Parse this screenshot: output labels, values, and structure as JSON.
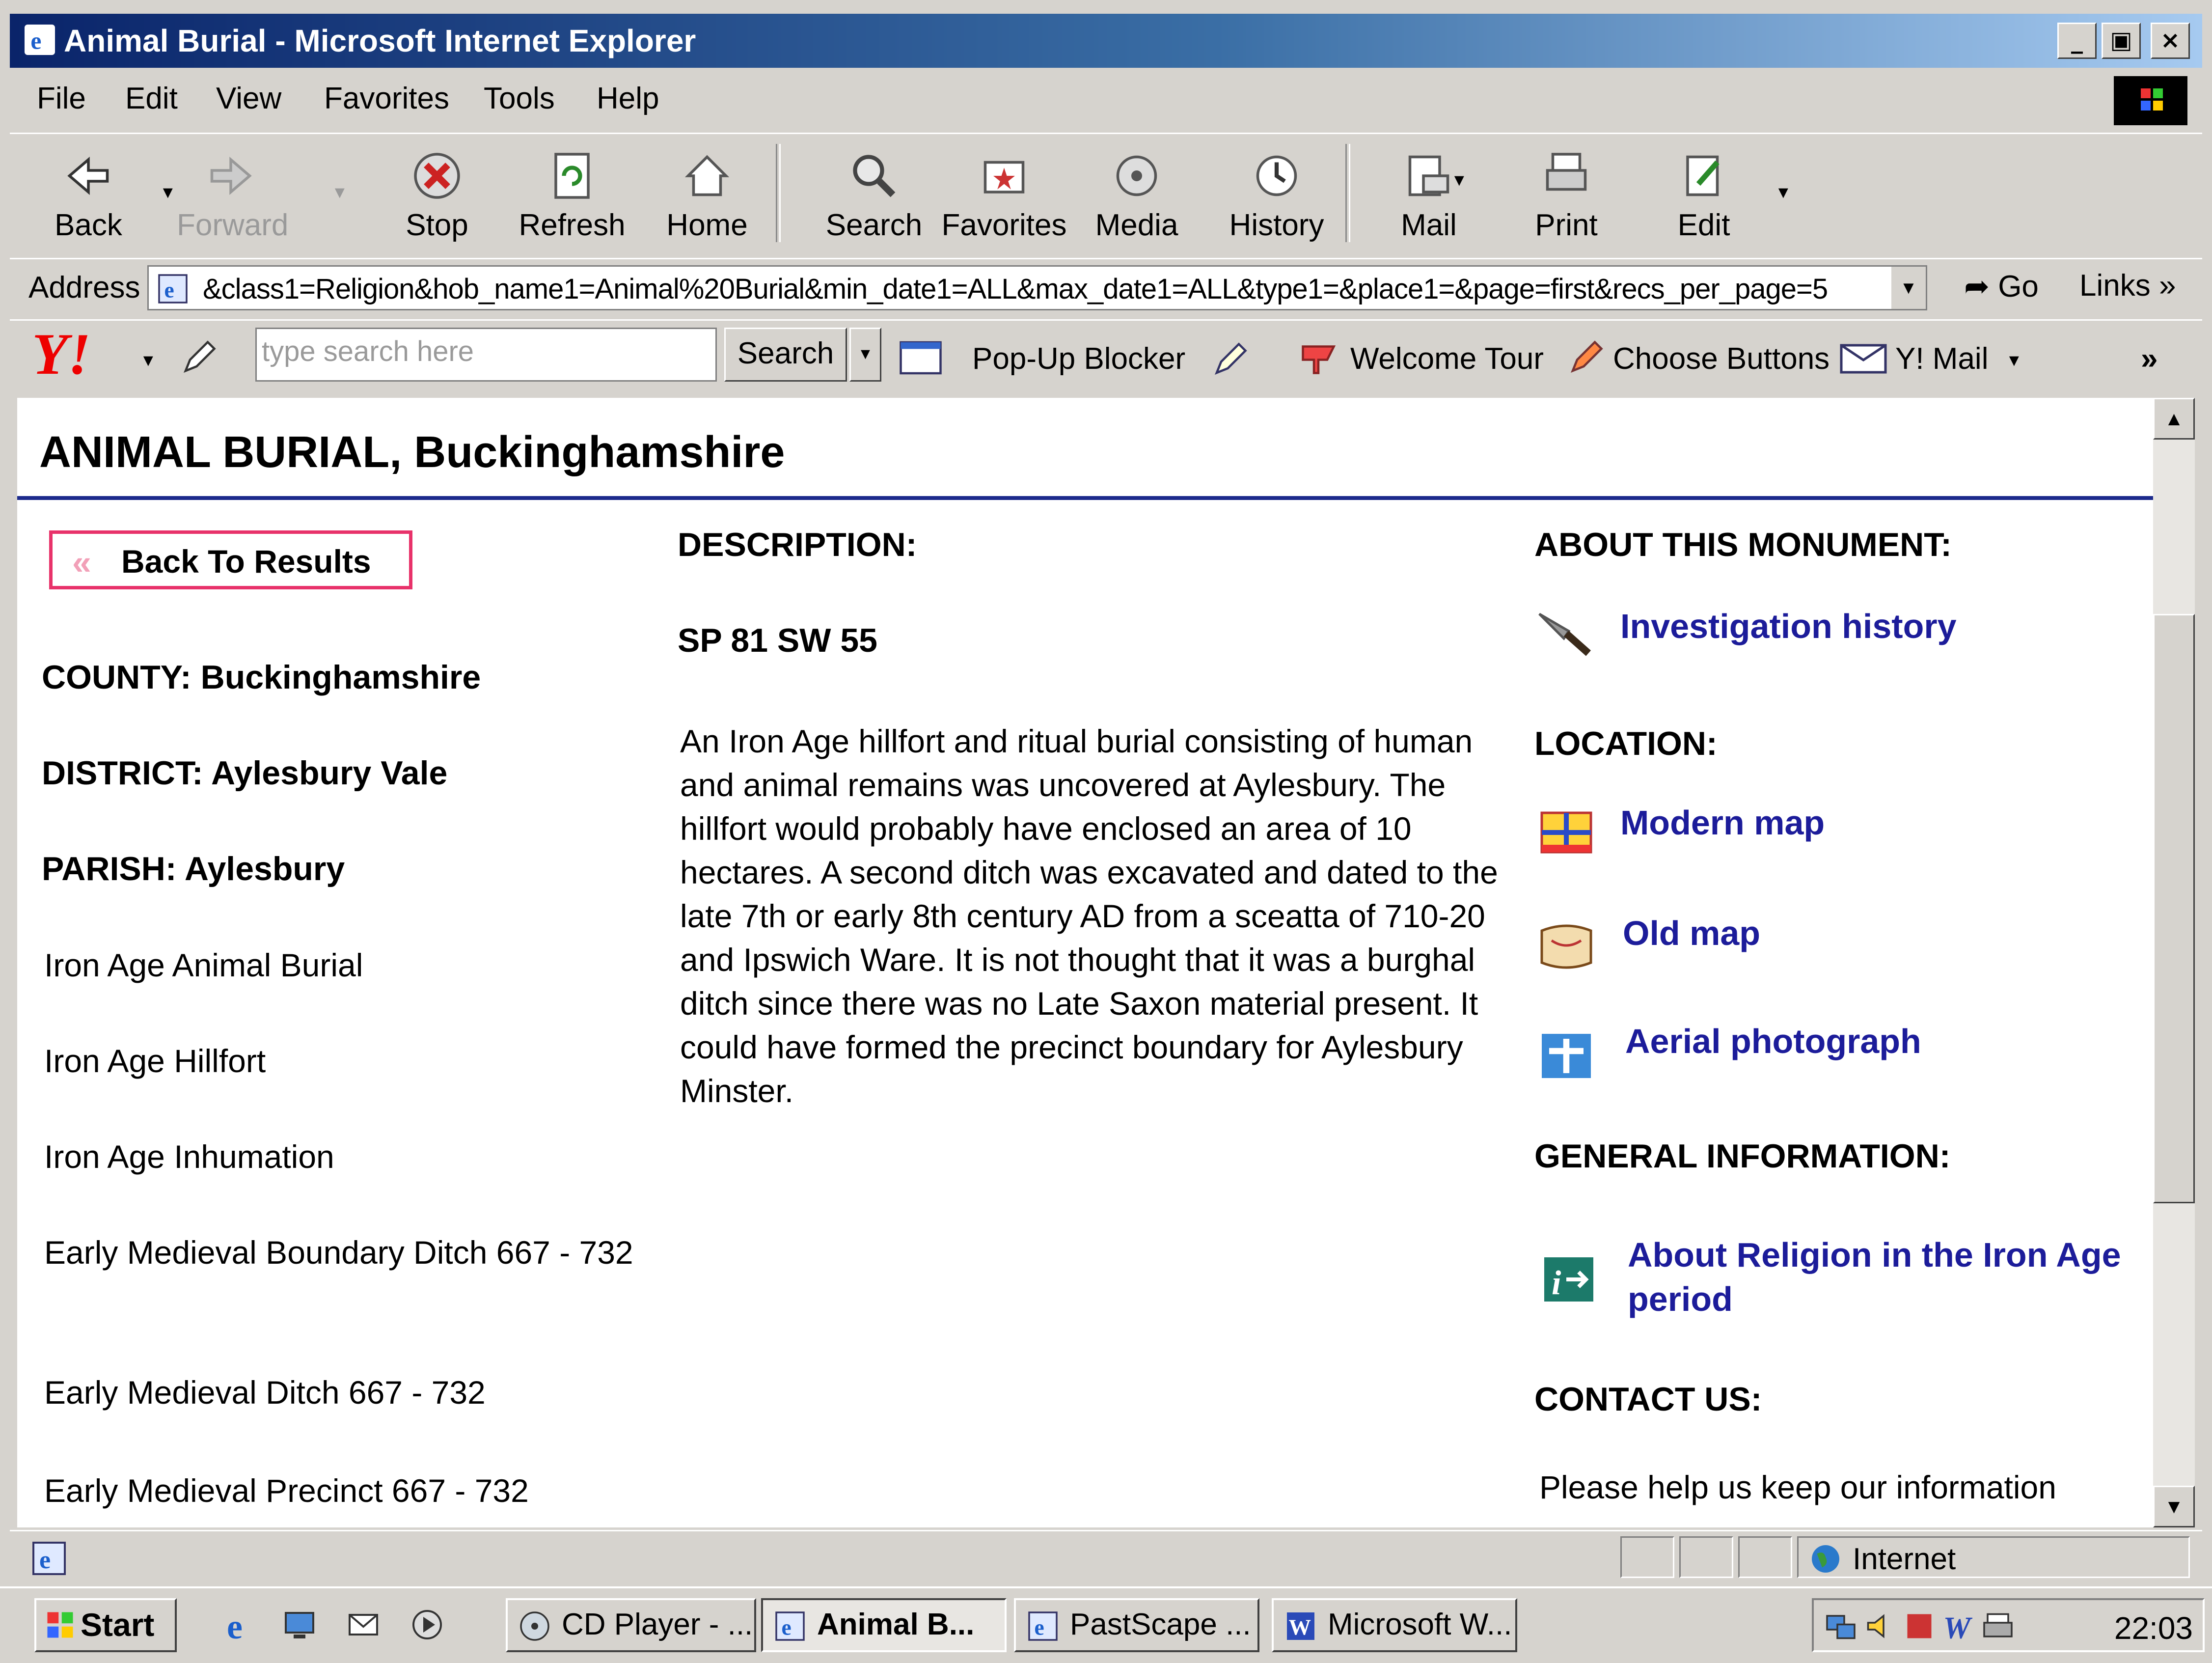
{
  "window": {
    "title": "Animal Burial - Microsoft Internet Explorer",
    "minimize": "_",
    "maximize": "▣",
    "close": "×"
  },
  "menu": [
    "File",
    "Edit",
    "View",
    "Favorites",
    "Tools",
    "Help"
  ],
  "toolbar": {
    "back": "Back",
    "forward": "Forward",
    "stop": "Stop",
    "refresh": "Refresh",
    "home": "Home",
    "search": "Search",
    "favorites": "Favorites",
    "media": "Media",
    "history": "History",
    "mail": "Mail",
    "print": "Print",
    "edit": "Edit"
  },
  "address": {
    "label": "Address",
    "url": "&class1=Religion&hob_name1=Animal%20Burial&min_date1=ALL&max_date1=ALL&type1=&place1=&page=first&recs_per_page=5",
    "go": "Go",
    "links": "Links »"
  },
  "yahoo": {
    "logo": "Y!",
    "search_placeholder": "type search here",
    "search_button": "Search",
    "popup_blocker": "Pop-Up Blocker",
    "welcome_tour": "Welcome Tour",
    "choose_buttons": "Choose Buttons",
    "mail": "Y! Mail",
    "more": "»"
  },
  "page": {
    "title": "ANIMAL BURIAL, Buckinghamshire",
    "back_button": "Back To Results",
    "county": "COUNTY: Buckinghamshire",
    "district": "DISTRICT: Aylesbury Vale",
    "parish": "PARISH: Aylesbury",
    "classifications": [
      "Iron Age Animal Burial",
      "Iron Age Hillfort",
      "Iron Age Inhumation",
      "Early Medieval Boundary Ditch  667 - 732",
      "Early Medieval Ditch  667 - 732",
      "Early Medieval Precinct  667 - 732"
    ],
    "description_heading": "DESCRIPTION:",
    "grid_ref": "SP 81 SW 55",
    "description": "An Iron Age hillfort and ritual burial consisting of human and animal remains was uncovered at Aylesbury. The hillfort would probably have enclosed an area of 10 hectares. A second ditch was excavated and dated to the late 7th or early 8th century AD from a sceatta of 710-20 and Ipswich Ware. It is not thought that it was a burghal ditch since there was no Late Saxon material present. It could have formed the precinct boundary for Aylesbury Minster.",
    "about_heading": "ABOUT THIS MONUMENT:",
    "investigation_history": "Investigation history",
    "location_heading": "LOCATION:",
    "modern_map": "Modern map",
    "old_map": "Old map",
    "aerial_photograph": "Aerial photograph",
    "general_heading": "GENERAL INFORMATION:",
    "about_religion": "About Religion in the Iron Age period",
    "contact_heading": "CONTACT US:",
    "contact_text": "Please help us keep our information"
  },
  "status": {
    "zone": "Internet"
  },
  "taskbar": {
    "start": "Start",
    "tasks": [
      "CD Player - ...",
      "Animal B...",
      "PastScape ...",
      "Microsoft W..."
    ],
    "clock": "22:03"
  },
  "colors": {
    "title_bar_start": "#0a246a",
    "title_bar_end": "#a6caf0",
    "link": "#1c1c9a",
    "title_rule": "#1c2a8c",
    "back_border": "#e8326a"
  }
}
